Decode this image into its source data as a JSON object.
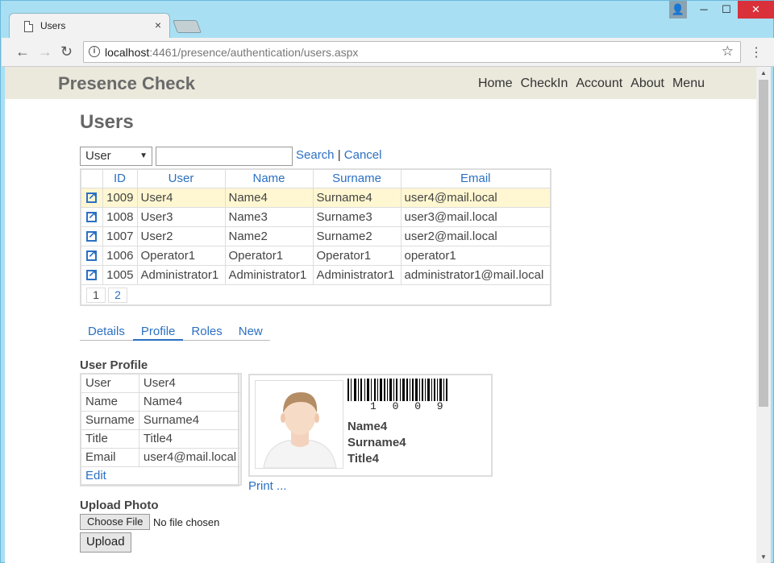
{
  "browser": {
    "tab_title": "Users",
    "tab_close": "×",
    "url_host": "localhost",
    "url_rest": ":4461/presence/authentication/users.aspx",
    "win_min": "─",
    "win_max": "☐",
    "win_close": "✕"
  },
  "site": {
    "brand": "Presence Check",
    "nav": [
      "Home",
      "CheckIn",
      "Account",
      "About",
      "Menu"
    ]
  },
  "page": {
    "title": "Users",
    "search": {
      "field_selected": "User",
      "input_value": "",
      "search_link": "Search",
      "separator": "|",
      "cancel_link": "Cancel"
    },
    "grid": {
      "headers": [
        "ID",
        "User",
        "Name",
        "Surname",
        "Email"
      ],
      "rows": [
        {
          "id": "1009",
          "user": "User4",
          "name": "Name4",
          "surname": "Surname4",
          "email": "user4@mail.local",
          "selected": true
        },
        {
          "id": "1008",
          "user": "User3",
          "name": "Name3",
          "surname": "Surname3",
          "email": "user3@mail.local",
          "selected": false
        },
        {
          "id": "1007",
          "user": "User2",
          "name": "Name2",
          "surname": "Surname2",
          "email": "user2@mail.local",
          "selected": false
        },
        {
          "id": "1006",
          "user": "Operator1",
          "name": "Operator1",
          "surname": "Operator1",
          "email": "operator1",
          "selected": false
        },
        {
          "id": "1005",
          "user": "Administrator1",
          "name": "Administrator1",
          "surname": "Administrator1",
          "email": "administrator1@mail.local",
          "selected": false
        }
      ],
      "pages": [
        "1",
        "2"
      ]
    },
    "tabs": [
      "Details",
      "Profile",
      "Roles",
      "New"
    ],
    "active_tab": "Profile",
    "profile": {
      "heading": "User Profile",
      "fields": [
        {
          "label": "User",
          "value": "User4"
        },
        {
          "label": "Name",
          "value": "Name4"
        },
        {
          "label": "Surname",
          "value": "Surname4"
        },
        {
          "label": "Title",
          "value": "Title4"
        },
        {
          "label": "Email",
          "value": "user4@mail.local"
        }
      ],
      "edit_link": "Edit"
    },
    "card": {
      "barcode_number": "1009",
      "barcode_digits": "1 0 0 9",
      "name": "Name4",
      "surname": "Surname4",
      "title": "Title4",
      "print_link": "Print ..."
    },
    "upload": {
      "heading": "Upload Photo",
      "choose_button": "Choose File",
      "no_file_text": "No file chosen",
      "upload_button": "Upload"
    }
  }
}
